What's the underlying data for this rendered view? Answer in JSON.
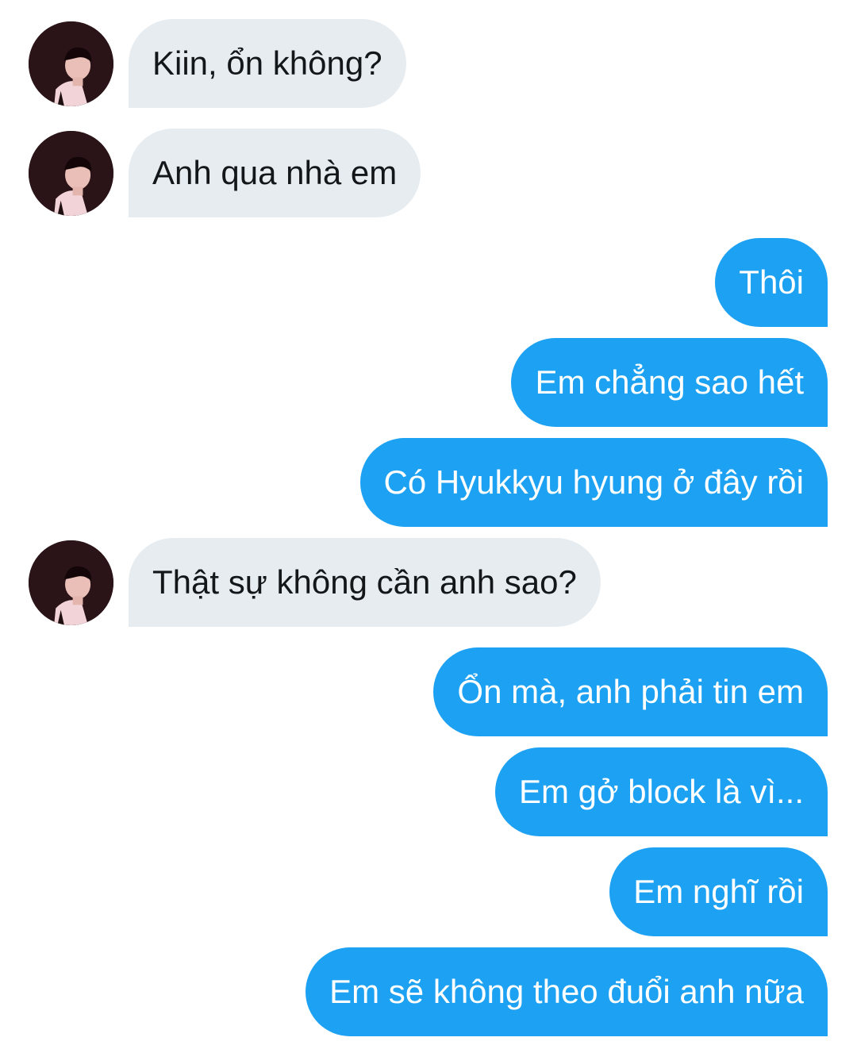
{
  "conversation": {
    "messages": [
      {
        "direction": "incoming",
        "text": "Kiin, ổn không?",
        "has_avatar": true
      },
      {
        "direction": "incoming",
        "text": "Anh qua nhà em",
        "has_avatar": true
      },
      {
        "direction": "outgoing",
        "text": "Thôi"
      },
      {
        "direction": "outgoing",
        "text": "Em chẳng sao hết"
      },
      {
        "direction": "outgoing",
        "text": "Có Hyukkyu hyung ở đây rồi"
      },
      {
        "direction": "incoming",
        "text": "Thật sự không cần anh sao?",
        "has_avatar": true
      },
      {
        "direction": "outgoing",
        "text": "Ổn mà, anh phải tin em"
      },
      {
        "direction": "outgoing",
        "text": "Em gở block là vì..."
      },
      {
        "direction": "outgoing",
        "text": "Em nghĩ rồi"
      },
      {
        "direction": "outgoing",
        "text": "Em sẽ không theo đuổi anh nữa"
      }
    ]
  },
  "colors": {
    "incoming_bubble": "#e6ecf0",
    "incoming_text": "#14171a",
    "outgoing_bubble": "#1da1f2",
    "outgoing_text": "#ffffff",
    "background": "#ffffff"
  },
  "icons": {
    "avatar": "profile-photo"
  }
}
